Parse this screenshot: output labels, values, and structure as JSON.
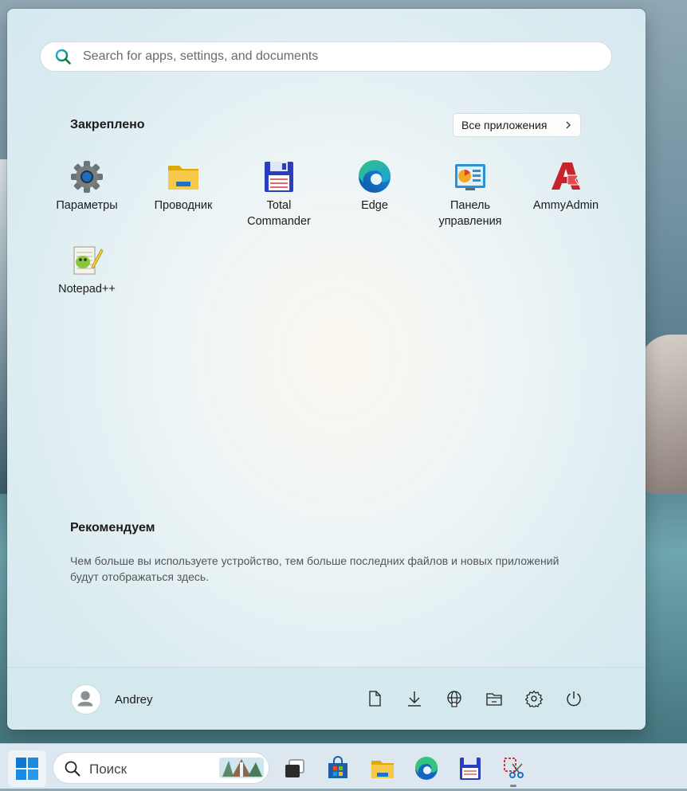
{
  "search": {
    "placeholder": "Search for apps, settings, and documents"
  },
  "pinned": {
    "title": "Закреплено",
    "all_apps_label": "Все приложения",
    "apps": [
      {
        "line1": "Параметры",
        "line2": ""
      },
      {
        "line1": "Проводник",
        "line2": ""
      },
      {
        "line1": "Total",
        "line2": "Commander"
      },
      {
        "line1": "Edge",
        "line2": ""
      },
      {
        "line1": "Панель",
        "line2": "управления"
      },
      {
        "line1": "AmmyAdmin",
        "line2": ""
      },
      {
        "line1": "Notepad++",
        "line2": ""
      }
    ]
  },
  "recommended": {
    "title": "Рекомендуем",
    "text": "Чем больше вы используете устройство, тем больше последних файлов и новых приложений будут отображаться здесь."
  },
  "footer": {
    "user_name": "Andrey"
  },
  "taskbar": {
    "search_label": "Поиск"
  },
  "colors": {
    "accent": "#0067c0",
    "folder": "#f5c400",
    "edge": "#1aa0e0"
  }
}
